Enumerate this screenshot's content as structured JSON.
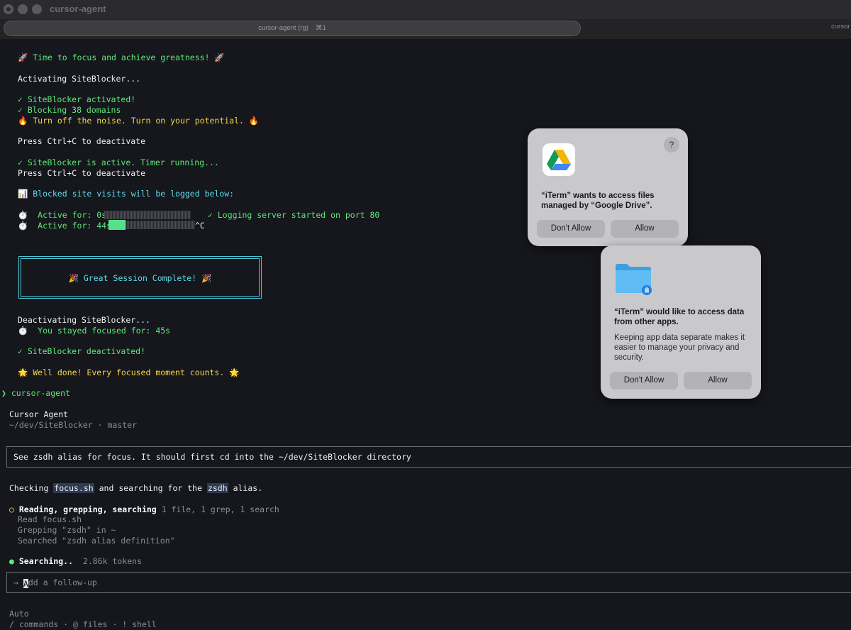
{
  "window": {
    "title": "cursor-agent",
    "active_tab": "cursor-agent (rg)",
    "active_tab_shortcut": "⌘1",
    "next_tab": "cursor"
  },
  "terminal": {
    "rocket_line": "🚀 Time to focus and achieve greatness! 🚀",
    "activating": "Activating SiteBlocker...",
    "activated": "✓ SiteBlocker activated!",
    "blocking": "✓ Blocking 38 domains",
    "noise": "🔥 Turn off the noise. Turn on your potential. 🔥",
    "press_ctrl_1": "Press Ctrl+C to deactivate",
    "active_timer": "✓ SiteBlocker is active. Timer running...",
    "press_ctrl_2": "Press Ctrl+C to deactivate",
    "blocked_log": "📊 Blocked site visits will be logged below:",
    "active_for_1": "⏱️  Active for: 0s",
    "logging_server": "✓ Logging server started on port 80",
    "active_for_2": "⏱️  Active for: 44s",
    "progress_2": 0.2,
    "ctrl_c_echo": "^C",
    "session_complete": "🎉 Great Session Complete! 🎉",
    "deactivating": "Deactivating SiteBlocker...",
    "stayed_focused": "⏱️  You stayed focused for: 45s",
    "deactivated": "✓ SiteBlocker deactivated!",
    "well_done": "🌟 Well done! Every focused moment counts. 🌟",
    "prompt_symbol": "❯",
    "prompt_command": "cursor-agent"
  },
  "agent": {
    "name": "Cursor Agent",
    "path": "~/dev/SiteBlocker · master",
    "user_message": "See zsdh alias for focus. It should first cd into the ~/dev/SiteBlocker directory",
    "checking_pre": "Checking ",
    "checking_file": "focus.sh",
    "checking_mid": " and searching for the ",
    "checking_alias": "zsdh",
    "checking_post": " alias.",
    "step_icon": "○",
    "step_title": "Reading, grepping, searching",
    "step_summary": "1 file, 1 grep, 1 search",
    "step_items": [
      "Read focus.sh",
      "Grepping \"zsdh\" in ~",
      "Searched \"zsdh alias definition\""
    ],
    "status_dot": "●",
    "status_label": "Searching..",
    "status_tokens": "2.86k tokens",
    "input_arrow": "→",
    "input_cursor_char": "A",
    "input_placeholder": "dd a follow-up",
    "mode": "Auto",
    "footer_hints": "/ commands · @ files · ! shell"
  },
  "dialog_drive": {
    "icon": "google-drive-icon",
    "help": "?",
    "message": "“iTerm” wants to access files managed by “Google Drive”.",
    "deny_label": "Don't Allow",
    "allow_label": "Allow"
  },
  "dialog_apps": {
    "icon": "folder-hand-icon",
    "message": "“iTerm” would like to access data from other apps.",
    "detail": "Keeping app data separate makes it easier to manage your privacy and security.",
    "deny_label": "Don't Allow",
    "allow_label": "Allow"
  },
  "colors": {
    "background": "#15171c",
    "green": "#5ee87a",
    "yellow": "#f3d54a",
    "cyan": "#5fdcf0"
  }
}
